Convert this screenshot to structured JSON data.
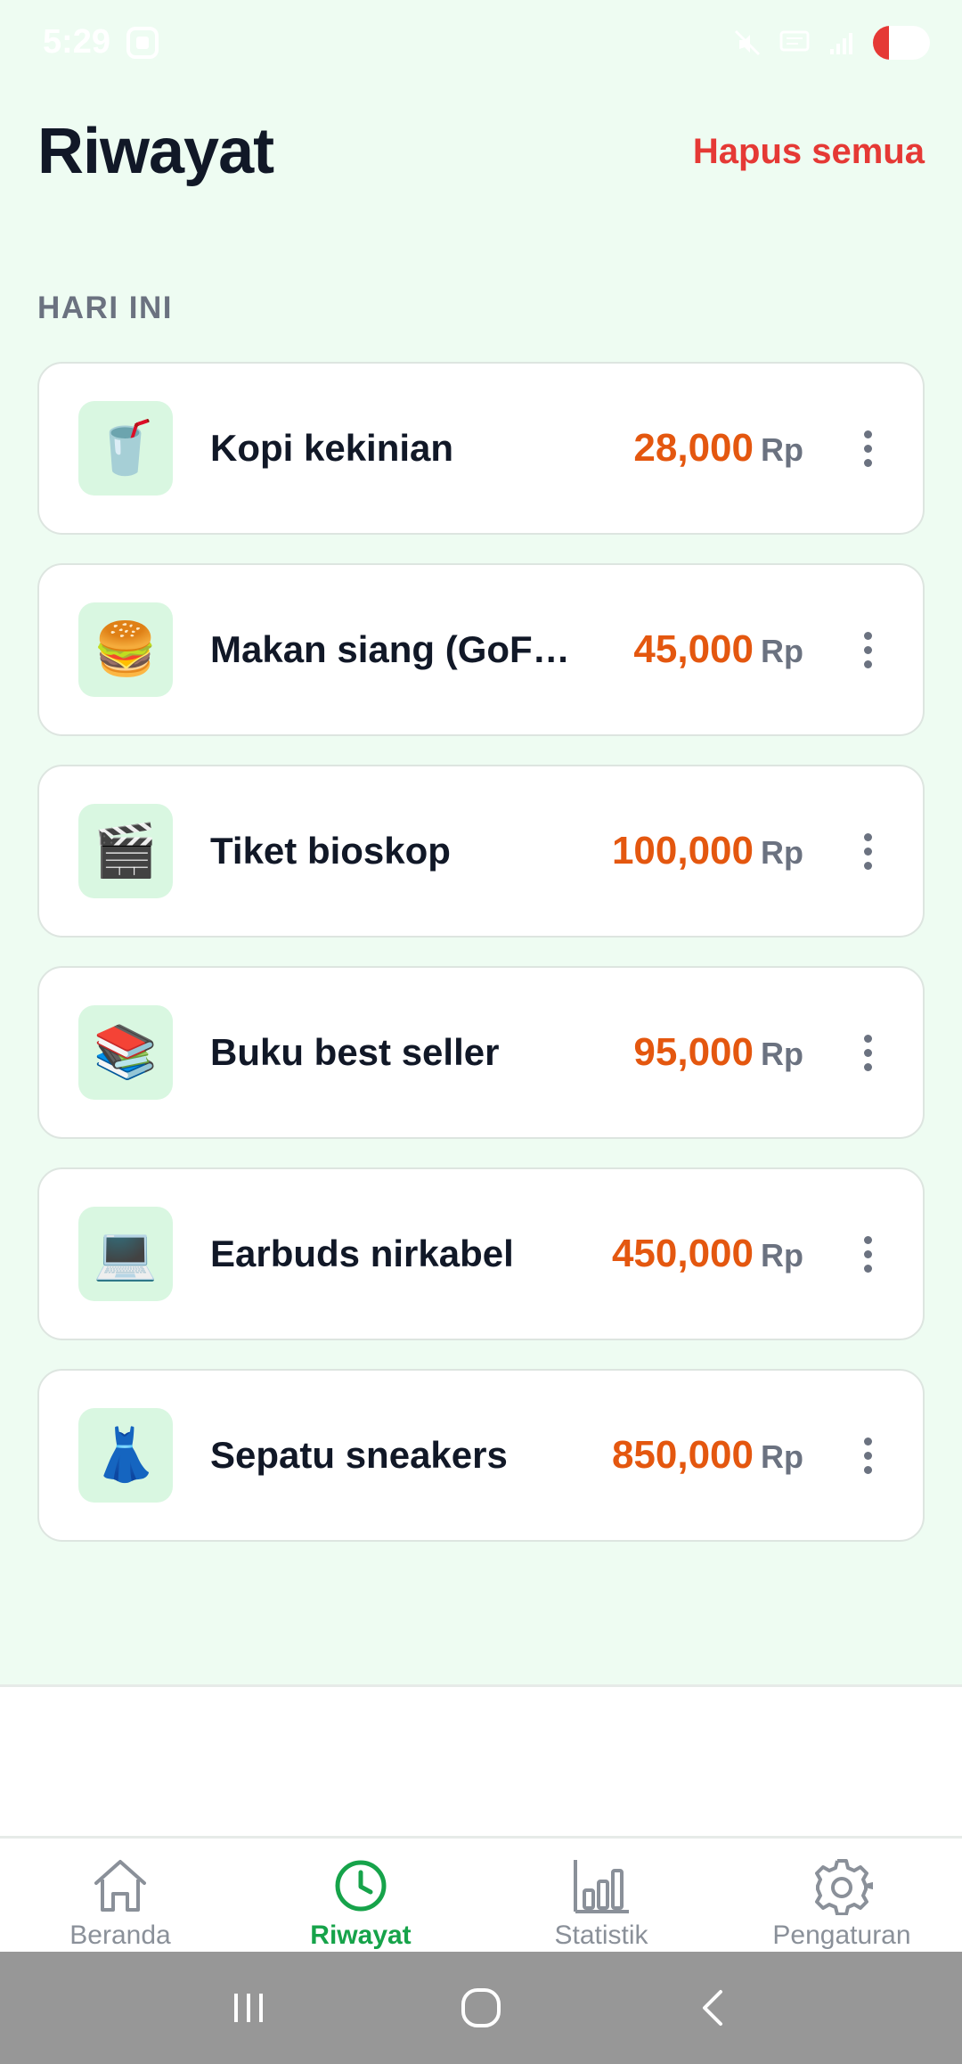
{
  "status_bar": {
    "time": "5:29",
    "battery": "15"
  },
  "header": {
    "title": "Riwayat",
    "clear_all": "Hapus semua"
  },
  "section": {
    "label": "HARI INI"
  },
  "transactions": [
    {
      "icon": "🥤",
      "icon_name": "drink-cup-icon",
      "name": "Kopi kekinian",
      "amount": "28,000",
      "currency": "Rp"
    },
    {
      "icon": "🍔",
      "icon_name": "burger-icon",
      "name": "Makan siang (GoFood)",
      "amount": "45,000",
      "currency": "Rp"
    },
    {
      "icon": "🎬",
      "icon_name": "clapperboard-icon",
      "name": "Tiket bioskop",
      "amount": "100,000",
      "currency": "Rp"
    },
    {
      "icon": "📚",
      "icon_name": "books-icon",
      "name": "Buku best seller",
      "amount": "95,000",
      "currency": "Rp"
    },
    {
      "icon": "💻",
      "icon_name": "laptop-icon",
      "name": "Earbuds nirkabel",
      "amount": "450,000",
      "currency": "Rp"
    },
    {
      "icon": "👗",
      "icon_name": "dress-icon",
      "name": "Sepatu sneakers",
      "amount": "850,000",
      "currency": "Rp"
    }
  ],
  "tabs": [
    {
      "label": "Beranda",
      "icon": "home-icon",
      "active": false
    },
    {
      "label": "Riwayat",
      "icon": "clock-icon",
      "active": true
    },
    {
      "label": "Statistik",
      "icon": "bar-chart-icon",
      "active": false
    },
    {
      "label": "Pengaturan",
      "icon": "gear-icon",
      "active": false
    }
  ],
  "colors": {
    "background": "#eefcf2",
    "accent": "#16a34a",
    "amount": "#e4570f",
    "danger": "#e53935"
  }
}
